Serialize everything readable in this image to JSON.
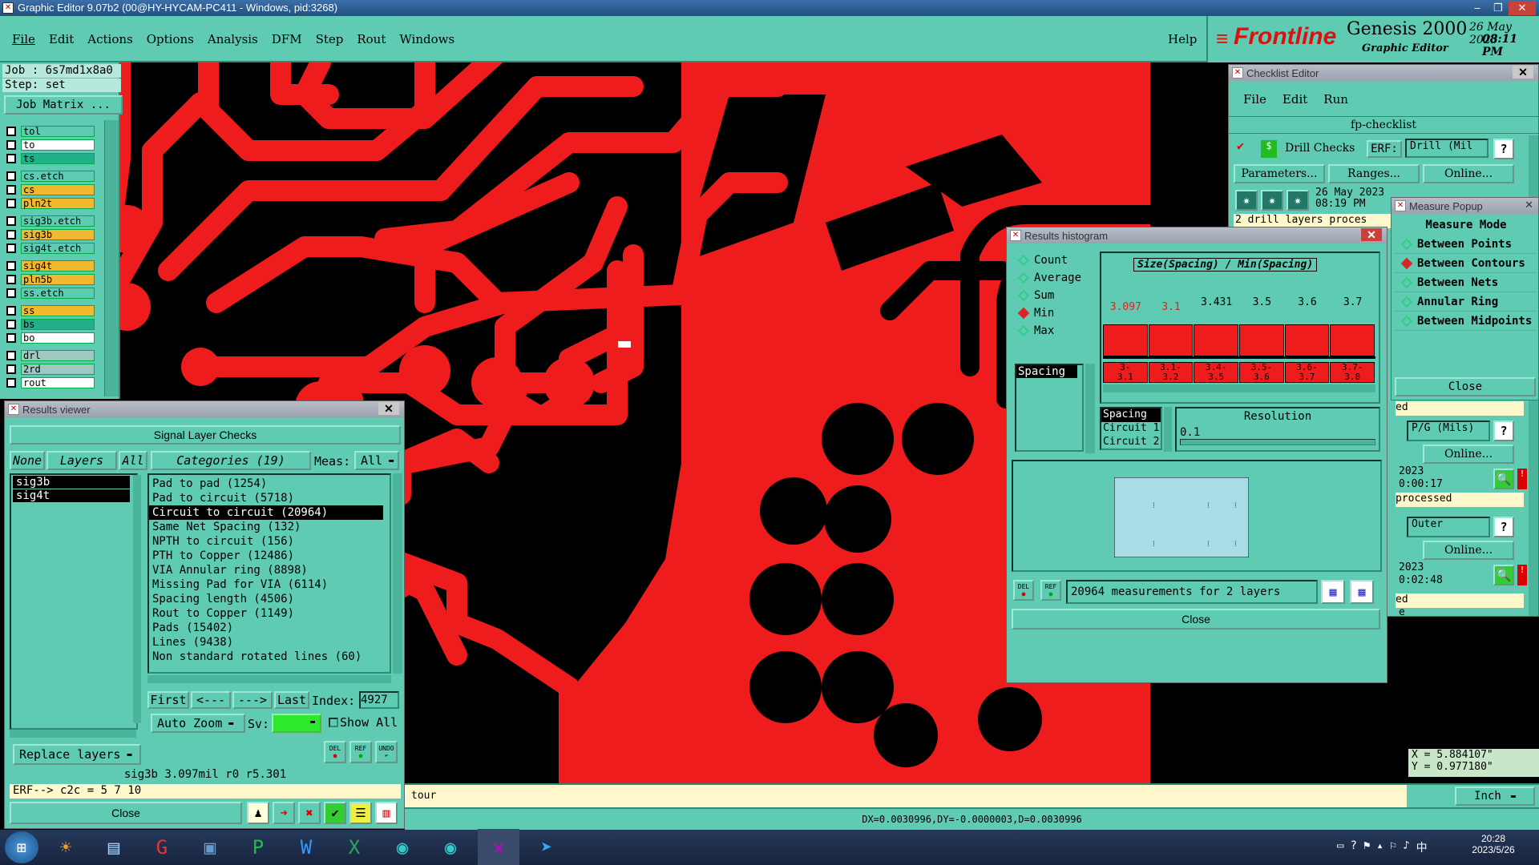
{
  "window": {
    "title": "Graphic Editor 9.07b2 (00@HY-HYCAM-PC411 - Windows, pid:3268)"
  },
  "menu": {
    "items": [
      "File",
      "Edit",
      "Actions",
      "Options",
      "Analysis",
      "DFM",
      "Step",
      "Rout",
      "Windows"
    ],
    "help": "Help"
  },
  "brand": {
    "logo": "Frontline",
    "product": "Genesis 2000",
    "subtitle": "Graphic Editor",
    "date": "26 May 2023",
    "time": "08:11 PM"
  },
  "job": {
    "job": "Job  : 6s7md1x8a0",
    "step": "Step: set",
    "matrix_btn": "Job Matrix ..."
  },
  "layers": [
    {
      "name": "tol",
      "color": "#5fcbb2"
    },
    {
      "name": "to",
      "color": "#ffffff"
    },
    {
      "name": "ts",
      "color": "#22b08a"
    },
    {
      "name": "cs.etch",
      "color": "#5fcbb2"
    },
    {
      "name": "cs",
      "color": "#f2b830"
    },
    {
      "name": "pln2t",
      "color": "#f2b830"
    },
    {
      "name": "sig3b.etch",
      "color": "#5fcbb2"
    },
    {
      "name": "sig3b",
      "color": "#f2b830"
    },
    {
      "name": "sig4t.etch",
      "color": "#5fcbb2"
    },
    {
      "name": "sig4t",
      "color": "#f2b830"
    },
    {
      "name": "pln5b",
      "color": "#f2b830"
    },
    {
      "name": "ss.etch",
      "color": "#5fcbb2"
    },
    {
      "name": "ss",
      "color": "#f2b830"
    },
    {
      "name": "bs",
      "color": "#22b08a"
    },
    {
      "name": "bo",
      "color": "#ffffff"
    },
    {
      "name": "drl",
      "color": "#9dc9c0"
    },
    {
      "name": "2rd",
      "color": "#9dc9c0"
    },
    {
      "name": "rout",
      "color": "#ffffff"
    }
  ],
  "results_viewer": {
    "title": "Results viewer",
    "header": "Signal Layer Checks",
    "none_btn": "None",
    "layers_btn": "Layers",
    "all_btn": "All",
    "categories_btn": "Categories (19)",
    "meas_label": "Meas:",
    "meas_value": "All",
    "layer_list": [
      "sig3b",
      "sig4t"
    ],
    "categories": [
      "Pad to pad (1254)",
      "Pad to circuit (5718)",
      "Circuit to circuit (20964)",
      "Same Net Spacing (132)",
      "NPTH to circuit (156)",
      "PTH to Copper (12486)",
      "VIA Annular ring (8898)",
      "Missing Pad for VIA (6114)",
      "Spacing length (4506)",
      "Rout to Copper (1149)",
      "Pads (15402)",
      "Lines (9438)",
      "Non standard rotated lines (60)"
    ],
    "selected_category": 2,
    "first_btn": "First",
    "prev_btn": "<---",
    "next_btn": "--->",
    "last_btn": "Last",
    "index_label": "Index:",
    "index_value": "4927",
    "auto_zoom": "Auto Zoom",
    "sv_label": "Sv:",
    "show_all": "Show All",
    "replace_layers": "Replace layers",
    "status": "sig3b 3.097mil  r0  r5.301",
    "erf_line": "ERF--> c2c = 5 7 10",
    "close_btn": "Close",
    "del_label": "DEL",
    "ref_label": "REF",
    "undo_label": "UNDO"
  },
  "checklist": {
    "title": "Checklist Editor",
    "menu": [
      "File",
      "Edit",
      "Run"
    ],
    "name": "fp-checklist",
    "drill_checks": "Drill Checks",
    "erf_label": "ERF:",
    "erf_value": "Drill (Mil",
    "parameters_btn": "Parameters...",
    "ranges_btn": "Ranges...",
    "online_btn": "Online...",
    "date": "26 May 2023",
    "time": "08:19 PM",
    "drill_msg": "2 drill layers proces",
    "row2_suffix": "ed",
    "pg_value": "P/G (Mils)",
    "online2": "Online...",
    "year2": "2023",
    "time2": "0:00:17",
    "processed": "processed",
    "outer_value": "Outer",
    "online3": "Online...",
    "year3": "2023",
    "time3": "0:02:48",
    "row3_suffix": "ed",
    "tail": "e"
  },
  "measure": {
    "title": "Measure Popup",
    "mode_label": "Measure Mode",
    "modes": [
      "Between Points",
      "Between Contours",
      "Between Nets",
      "Annular Ring",
      "Between Midpoints"
    ],
    "selected": 1,
    "close_btn": "Close",
    "x": "X = 5.884107\"",
    "y": "Y = 0.977180\"",
    "units": "Inch"
  },
  "histogram": {
    "title": "Results histogram",
    "stats": [
      "Count",
      "Average",
      "Sum",
      "Min",
      "Max"
    ],
    "selected_stat": 3,
    "list_item": "Spacing",
    "chart_title": "Size(Spacing) / Min(Spacing)",
    "bar_values": [
      "3.097",
      "3.1",
      "3.431",
      "3.5",
      "3.6",
      "3.7"
    ],
    "bins": [
      "3-\n3.1",
      "3.1-\n3.2",
      "3.4-\n3.5",
      "3.5-\n3.6",
      "3.6-\n3.7",
      "3.7-\n3.8"
    ],
    "value_colors": [
      "#d22",
      "#d22",
      "#000",
      "#000",
      "#000",
      "#000"
    ],
    "attr_list": [
      "Spacing",
      "Circuit 1",
      "Circuit 2"
    ],
    "resolution_label": "Resolution",
    "resolution_value": "0.1",
    "summary": "20964 measurements for 2 layers",
    "close_btn": "Close"
  },
  "status_bar": {
    "prompt": "tour",
    "coords": "DX=0.0030996,DY=-0.0000003,D=0.0030996"
  },
  "taskbar": {
    "time": "20:28",
    "date": "2023/5/26"
  }
}
